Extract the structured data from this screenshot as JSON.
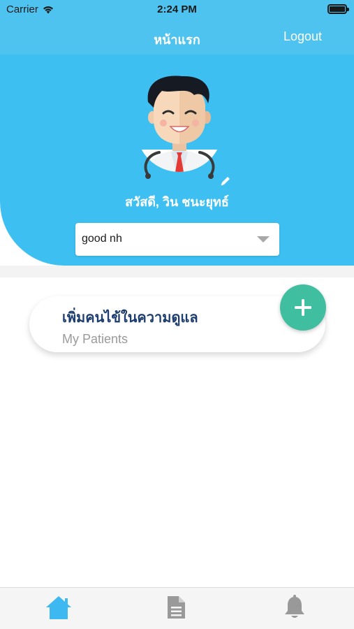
{
  "status_bar": {
    "carrier": "Carrier",
    "time": "2:24 PM"
  },
  "nav": {
    "title": "หน้าแรก",
    "logout_label": "Logout"
  },
  "profile": {
    "greeting": "สวัสดี, วิน ชนะยุทธ์",
    "avatar": "doctor-avatar"
  },
  "facility_select": {
    "selected_value": "good nh"
  },
  "patient_card": {
    "title": "เพิ่มคนไข้ในความดูแล",
    "subtitle": "My Patients"
  },
  "tab_bar": {
    "items": [
      {
        "icon": "home-icon",
        "active": true
      },
      {
        "icon": "document-icon",
        "active": false
      },
      {
        "icon": "bell-icon",
        "active": false
      }
    ]
  },
  "colors": {
    "primary": "#3dbff2",
    "navbar": "#4fc3f0",
    "accent_green": "#3fbf9f",
    "card_title": "#1c3d6e",
    "tab_active": "#3db8f0",
    "tab_inactive": "#999999"
  }
}
